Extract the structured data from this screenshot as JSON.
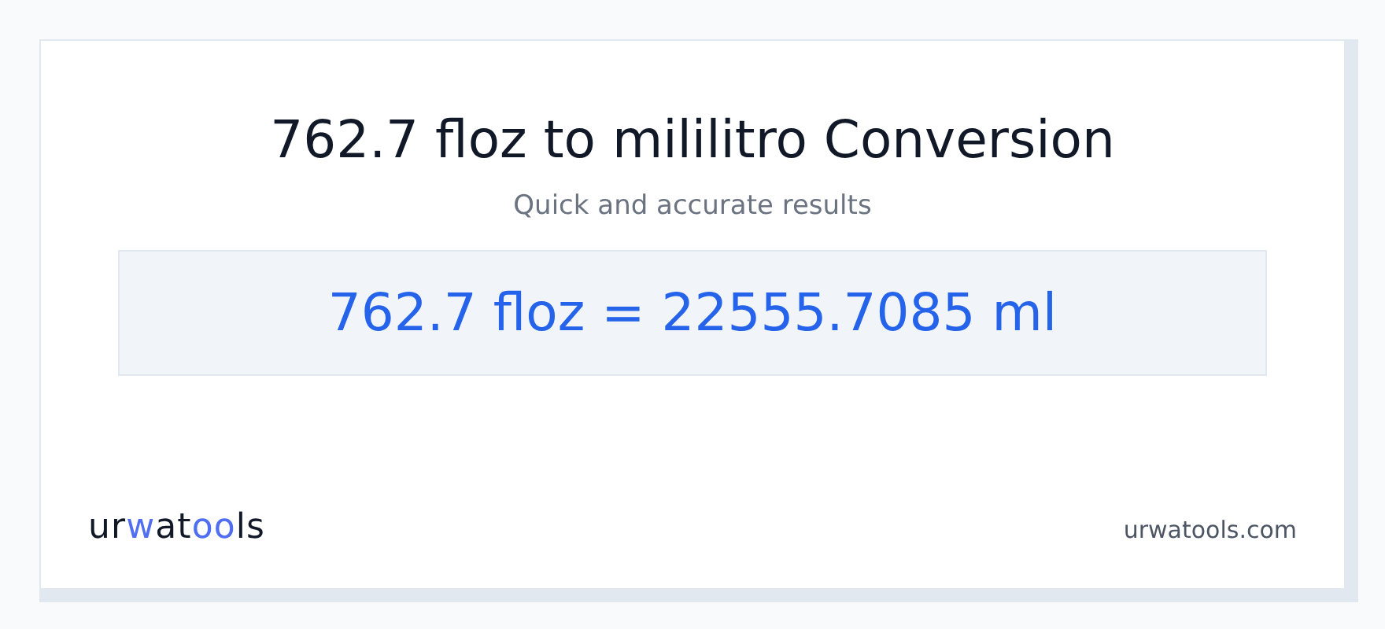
{
  "title": "762.7 floz to mililitro Conversion",
  "subtitle": "Quick and accurate results",
  "result": "762.7 floz = 22555.7085 ml",
  "logo": [
    {
      "text": "ur",
      "accent": false
    },
    {
      "text": "w",
      "accent": true
    },
    {
      "text": "at",
      "accent": false
    },
    {
      "text": "oo",
      "accent": true
    },
    {
      "text": "ls",
      "accent": false
    }
  ],
  "site": "urwatools.com"
}
